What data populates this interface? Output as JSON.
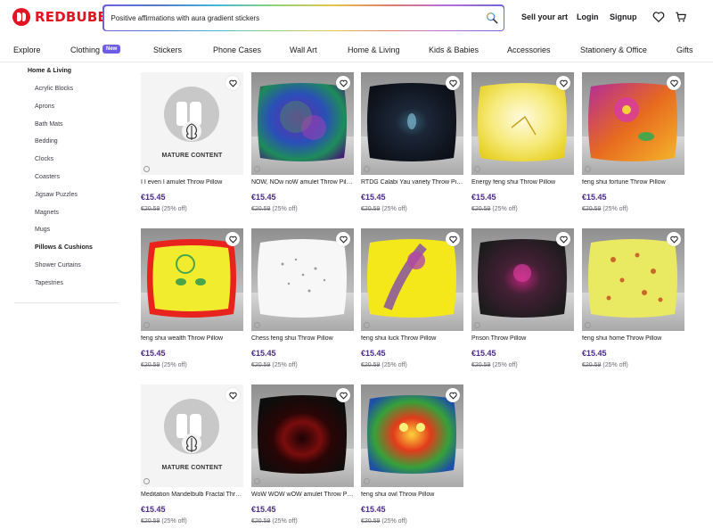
{
  "brand": {
    "name": "REDBUBBLE",
    "color": "#e41321"
  },
  "search": {
    "value": "Positive affirmations with aura gradient stickers",
    "icon": "search-icon"
  },
  "header_links": {
    "sell": "Sell your art",
    "login": "Login",
    "signup": "Signup"
  },
  "nav": {
    "items": [
      "Explore",
      "Clothing",
      "Stickers",
      "Phone Cases",
      "Wall Art",
      "Home & Living",
      "Kids & Babies",
      "Accessories",
      "Stationery & Office",
      "Gifts"
    ],
    "badge": "New"
  },
  "sidebar": {
    "heading": "Home & Living",
    "items": [
      "Acrylic Blocks",
      "Aprons",
      "Bath Mats",
      "Bedding",
      "Clocks",
      "Coasters",
      "Jigsaw Puzzles",
      "Magnets",
      "Mugs",
      "Pillows & Cushions",
      "Shower Curtains",
      "Tapestries"
    ],
    "active": "Pillows & Cushions"
  },
  "mature_label": "MATURE CONTENT",
  "products": [
    {
      "title": "I I even I amulet Throw Pillow",
      "price": "€15.45",
      "original": "€20.59",
      "discount": "(25% off)",
      "mature": true
    },
    {
      "title": "NOW, NOw noW amulet Throw Pillow",
      "price": "€15.45",
      "original": "€20.59",
      "discount": "(25% off)",
      "mature": false
    },
    {
      "title": "RTDG Calabi Yau variety Throw Pillow",
      "price": "€15.45",
      "original": "€20.59",
      "discount": "(25% off)",
      "mature": false
    },
    {
      "title": "Energy feng shui Throw Pillow",
      "price": "€15.45",
      "original": "€20.59",
      "discount": "(25% off)",
      "mature": false
    },
    {
      "title": "feng shui fortune Throw Pillow",
      "price": "€15.45",
      "original": "€20.59",
      "discount": "(25% off)",
      "mature": false
    },
    {
      "title": "feng shui wealth Throw Pillow",
      "price": "€15.45",
      "original": "€20.59",
      "discount": "(25% off)",
      "mature": false
    },
    {
      "title": "Chess feng shui Throw Pillow",
      "price": "€15.45",
      "original": "€20.59",
      "discount": "(25% off)",
      "mature": false
    },
    {
      "title": "feng shui luck Throw Pillow",
      "price": "€15.45",
      "original": "€20.59",
      "discount": "(25% off)",
      "mature": false
    },
    {
      "title": "Prison Throw Pillow",
      "price": "€15.45",
      "original": "€20.59",
      "discount": "(25% off)",
      "mature": false
    },
    {
      "title": "feng shui home Throw Pillow",
      "price": "€15.45",
      "original": "€20.59",
      "discount": "(25% off)",
      "mature": false
    },
    {
      "title": "Meditation Mandelbulb Fractal Throw Pillow",
      "price": "€15.45",
      "original": "€20.59",
      "discount": "(25% off)",
      "mature": true
    },
    {
      "title": "WoW WOW wOW amulet Throw Pillow",
      "price": "€15.45",
      "original": "€20.59",
      "discount": "(25% off)",
      "mature": false
    },
    {
      "title": "feng shui owl Throw Pillow",
      "price": "€15.45",
      "original": "€20.59",
      "discount": "(25% off)",
      "mature": false
    }
  ],
  "colors": {
    "price": "#4b2b8a",
    "badge": "#6c5ce7"
  }
}
